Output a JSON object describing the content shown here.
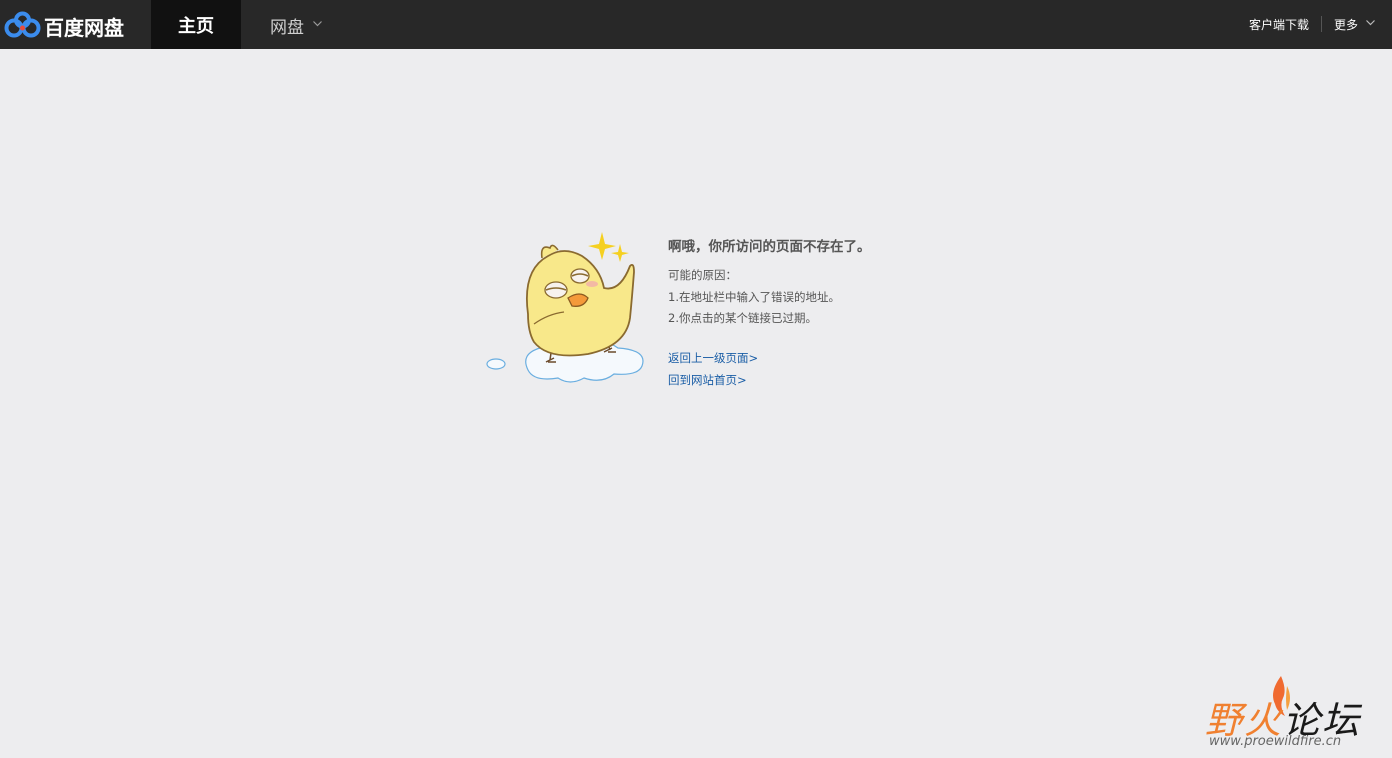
{
  "header": {
    "logo_text": "百度网盘",
    "nav_home": "主页",
    "nav_pan": "网盘",
    "client_download": "客户端下载",
    "more": "更多"
  },
  "error": {
    "title": "啊哦，你所访问的页面不存在了。",
    "reasons_heading": "可能的原因：",
    "reasons": [
      "1.在地址栏中输入了错误的地址。",
      "2.你点击的某个链接已过期。"
    ],
    "links": {
      "back": "返回上一级页面>",
      "home": "回到网站首页>"
    }
  },
  "watermark": {
    "text_part1": "野火",
    "text_part2": "论坛",
    "url": "www.proewildfire.cn"
  },
  "colors": {
    "topbar": "#282828",
    "active_tab": "#111111",
    "background": "#ededef",
    "link": "#1b5ea6",
    "brand_blue": "#3b8ced"
  }
}
